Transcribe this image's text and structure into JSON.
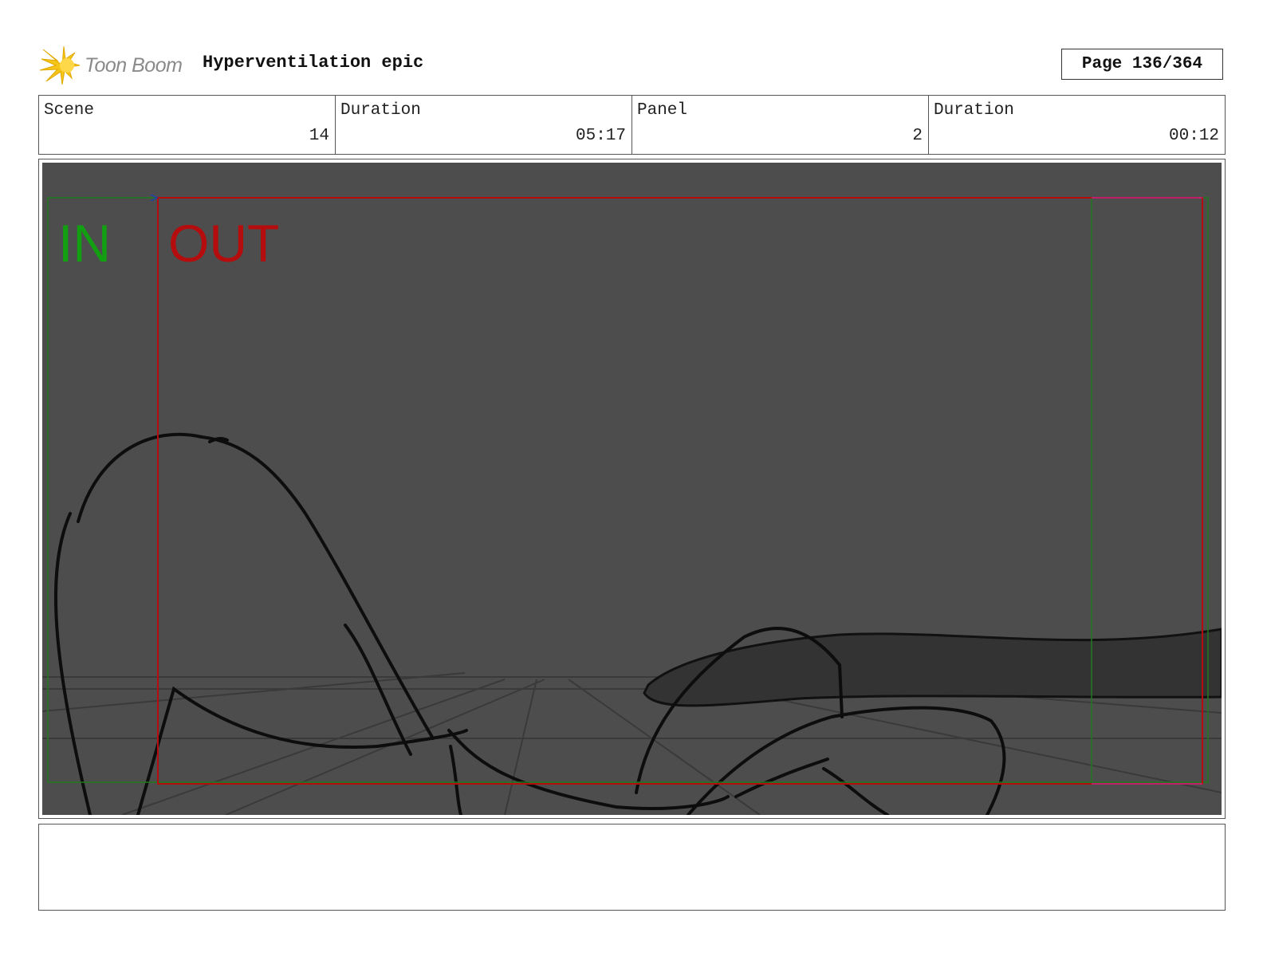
{
  "header": {
    "logo_text": "Toon Boom",
    "title": "Hyperventilation epic",
    "page": "Page 136/364"
  },
  "info": {
    "scene_label": "Scene",
    "scene_value": "14",
    "scene_duration_label": "Duration",
    "scene_duration_value": "05:17",
    "panel_label": "Panel",
    "panel_value": "2",
    "panel_duration_label": "Duration",
    "panel_duration_value": "00:12"
  },
  "panel": {
    "in_label": "IN",
    "out_label": "OUT",
    "background_color": "#4d4d4d",
    "in_color": "#12a012",
    "out_color": "#b50d0d"
  },
  "notes": {
    "text": ""
  }
}
